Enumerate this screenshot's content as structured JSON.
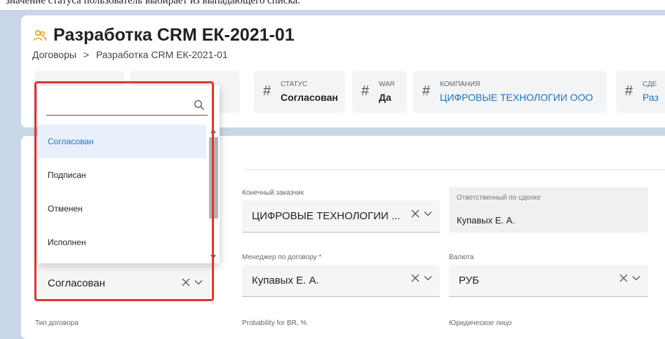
{
  "instruction_strip": "значение статуса пользователь выбирает из выпадающего списка.",
  "header": {
    "title": "Разработка CRM ЕК-2021-01",
    "breadcrumb": {
      "parent": "Договоры",
      "current": "Разработка CRM ЕК-2021-01",
      "separator": ">"
    }
  },
  "stats": {
    "hash": "#",
    "status": {
      "label": "СТАТУС",
      "value": "Согласован"
    },
    "war": {
      "label": "WAR",
      "value": "Да"
    },
    "company": {
      "label": "КОМПАНИЯ",
      "value": "ЦИФРОВЫЕ ТЕХНОЛОГИИ ООО"
    },
    "deal": {
      "label": "СДЕ",
      "value": "Раз"
    }
  },
  "fields": {
    "end_customer": {
      "label": "Конечный заказчик",
      "value": "ЦИФРОВЫЕ ТЕХНОЛОГИИ ..."
    },
    "responsible": {
      "label": "Ответственный по сделке",
      "value": "Купавых Е. А."
    },
    "contract_manager": {
      "label": "Менеджер по договору *",
      "value": "Купавых Е. А."
    },
    "currency": {
      "label": "Валюта",
      "value": "РУБ"
    },
    "status_select": {
      "value": "Согласован"
    },
    "contract_type": {
      "label": "Тип договора"
    },
    "probability": {
      "label": "Probability for BR, %"
    },
    "legal_entity": {
      "label": "Юридическое лицо"
    }
  },
  "dropdown": {
    "search_placeholder": "",
    "options": [
      "Согласован",
      "Подписан",
      "Отменен",
      "Исполнен"
    ],
    "selected": "Согласован"
  },
  "colors": {
    "accent": "#1a73c8",
    "highlight": "#e0332e",
    "title_icon": "#f39c12"
  }
}
